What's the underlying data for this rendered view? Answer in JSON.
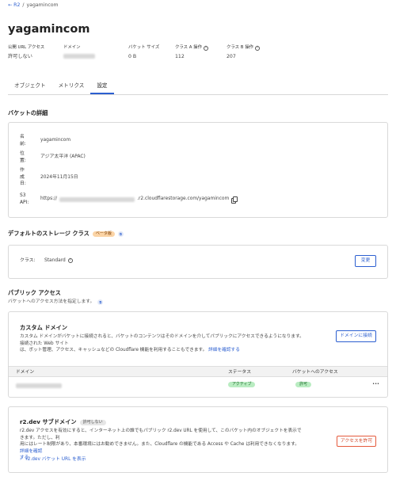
{
  "breadcrumb": {
    "back_label": "← R2",
    "separator": "/",
    "current": "yagamincom"
  },
  "page_title": "yagamincom",
  "stats": [
    {
      "label": "公開 URL アクセス",
      "value": "許可しない",
      "info": false,
      "blurred": false
    },
    {
      "label": "ドメイン",
      "value": "",
      "info": false,
      "blurred": true
    },
    {
      "label": "バケット サイズ",
      "value": "0 B",
      "info": false,
      "blurred": false
    },
    {
      "label": "クラス A 操作",
      "value": "112",
      "info": true,
      "blurred": false
    },
    {
      "label": "クラス B 操作",
      "value": "207",
      "info": true,
      "blurred": false
    }
  ],
  "tabs": [
    {
      "label": "オブジェクト",
      "active": false
    },
    {
      "label": "メトリクス",
      "active": false
    },
    {
      "label": "設定",
      "active": true
    }
  ],
  "bucket_details": {
    "heading": "バケットの詳細",
    "rows": [
      {
        "label": "名\n前:",
        "value": "yagamincom"
      },
      {
        "label": "位\n置:",
        "value": "アジア太平洋 (APAC)"
      },
      {
        "label": "作\n成\n日:",
        "value": "2024年11月15日"
      },
      {
        "label": "S3\nAPI:",
        "value_prefix": "https://",
        "value_suffix": ".r2.cloudflarestorage.com/yagamincom"
      }
    ]
  },
  "storage_class": {
    "heading": "デフォルトのストレージ クラス",
    "badge": "ベータ版",
    "label": "クラス:",
    "value": "Standard",
    "change_button": "変更"
  },
  "public_access": {
    "heading": "パブリック アクセス",
    "subtitle": "バケットへのアクセス方法を指定します。"
  },
  "custom_domain": {
    "title": "カスタム ドメイン",
    "desc_line1": "カスタム ドメインがバケットに接続されると、バケットのコンテンツはそのドメインを介してパブリックにアクセスできるようになります。接続された Web サイト",
    "desc_line2": "は、ボット管理、アクセス、キャッシュなどの Cloudflare 機能を利用することもできます。",
    "link": "詳細を確認する",
    "connect_button": "ドメインに接続",
    "table_headers": {
      "domain": "ドメイン",
      "status": "ステータス",
      "access": "バケットへのアクセス"
    },
    "rows": [
      {
        "domain": "",
        "status": "アクティブ",
        "access": "許可",
        "menu": "•••"
      }
    ]
  },
  "r2dev": {
    "title": "r2.dev サブドメイン",
    "badge": "許可しない",
    "desc_line1": "r2.dev アクセスを有効にすると、インターネット上の誰でもパブリック r2.dev URL を使用して、このバケット内のオブジェクトを表示できます。ただし、利",
    "desc_line2": "用にはレート制限があり、本番環境にはお勧めできません。また、Cloudflare の機能である Access や Cache は利用できなくなります。",
    "link_a": "詳細を確認",
    "link_b": "する",
    "allow_button": "アクセスを許可",
    "toggle_link": "r2.dev バケット URL を表示"
  },
  "colors": {
    "accent": "#2c5fd0",
    "danger": "#e55a3c",
    "active_green": "#b9ecc1",
    "beta_orange": "#fbd4a6"
  }
}
